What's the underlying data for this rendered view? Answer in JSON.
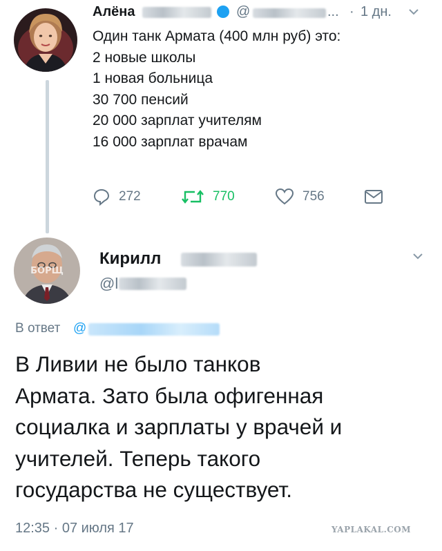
{
  "tweet1": {
    "author_name": "Алёна",
    "handle_prefix": "@",
    "handle_ellipsis": "...",
    "time_sep": "·",
    "time": "1 дн.",
    "lines": [
      "Один танк Армата (400 млн руб) это:",
      "2 новые школы",
      "1 новая больница",
      "30 700 пенсий",
      "20 000 зарплат учителям",
      "16 000 зарплат врачам"
    ],
    "actions": {
      "replies": "272",
      "retweets": "770",
      "likes": "756"
    }
  },
  "tweet2": {
    "author_name": "Кирилл",
    "handle_prefix": "@l",
    "reply_label": "В ответ",
    "reply_at": "@",
    "body_lines": [
      "В Ливии не было танков",
      "Армата. Зато была офигенная",
      "социалка и зарплаты у врачей и",
      "учителей. Теперь такого",
      "государства не существует."
    ],
    "timestamp": "12:35 · 07 июля 17",
    "avatar_stamp": "БОРЩ"
  },
  "watermark": "YAPLAKAL.COM",
  "colors": {
    "text": "#14171a",
    "secondary": "#657786",
    "accent_blue": "#1da1f2",
    "retweet_green": "#17bf63",
    "thread_line": "#ccd6dd"
  },
  "icons": {
    "reply": "reply-icon",
    "retweet": "retweet-icon",
    "like": "heart-icon",
    "dm": "envelope-icon",
    "menu": "chevron-down-icon",
    "verified": "verified-badge-icon"
  }
}
